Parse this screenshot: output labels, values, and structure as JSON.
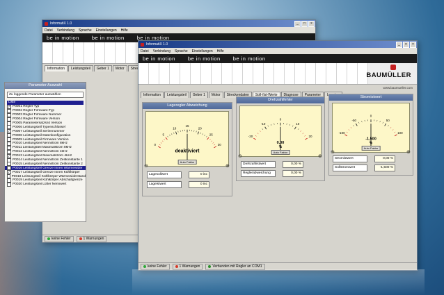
{
  "back_window": {
    "title": "InformatiX 1.0",
    "menu": [
      "Datei",
      "Verbindung",
      "Sprache",
      "Einstellungen",
      "Hilfe"
    ],
    "banner": [
      "be in motion",
      "be in motion",
      "be in motion"
    ],
    "tabs": [
      "Information",
      "Leistungsteil",
      "Geber 1",
      "Motor",
      "Streckenda"
    ],
    "param_panel": {
      "title": "Parameter Auswahl",
      "dropdown": "Zu loggende Parameter auswählen",
      "header": "Liste",
      "rows": [
        {
          "text": "P0001 Regler Typ",
          "checked": true,
          "hl": false
        },
        {
          "text": "P0002 Regler Firmware-Typ",
          "checked": false,
          "hl": false
        },
        {
          "text": "P0003 Regler Firmware Nummer",
          "checked": false,
          "hl": false
        },
        {
          "text": "P0004 Regler Firmware Version",
          "checked": false,
          "hl": false
        },
        {
          "text": "P0005 Parametersatzsnit Version",
          "checked": false,
          "hl": false
        },
        {
          "text": "P0006 Leistungsteil Typenschlüssel",
          "checked": false,
          "hl": false
        },
        {
          "text": "P0007 Leistungsteil Seriennummer",
          "checked": true,
          "hl": false
        },
        {
          "text": "P0008 Leistungsteil Datenkonfiguration",
          "checked": false,
          "hl": false
        },
        {
          "text": "P0009 Leistungsteil Firmware Version",
          "checked": false,
          "hl": false
        },
        {
          "text": "P0010 Leistungsteil Nennstrom 8kHz",
          "checked": false,
          "hl": false
        },
        {
          "text": "P0011 Leistungsteil Maximalstrom 8kHz",
          "checked": false,
          "hl": false
        },
        {
          "text": "P0012 Leistungsteil Nennstrom 4kHz",
          "checked": false,
          "hl": false
        },
        {
          "text": "P0013 Leistungsteil Maximalstrom 4kHz",
          "checked": true,
          "hl": false
        },
        {
          "text": "P0014 Leistungsteil Nennstrom Zeitkonstante 1",
          "checked": false,
          "hl": false
        },
        {
          "text": "P0015 Leistungsteil Nennstrom Zeitkonstante 2",
          "checked": false,
          "hl": false
        },
        {
          "text": "P0016 Leistungsteil Grenze Innen Wärmewider",
          "checked": false,
          "hl": true
        },
        {
          "text": "P0017 Leistungsteil Grenze Innen Kühlkörper",
          "checked": true,
          "hl": false
        },
        {
          "text": "P0018 Leistungsteil Kühlkörper Wärmewiderstand",
          "checked": false,
          "hl": false
        },
        {
          "text": "P0019 Leistungsteil Kühlkörper Abschaltgrenze",
          "checked": false,
          "hl": false
        },
        {
          "text": "P0020 Leistungsteil Lüfter Nennwert",
          "checked": false,
          "hl": false
        }
      ]
    },
    "status": [
      "keine Fehler",
      "1 Warnungen"
    ]
  },
  "front_window": {
    "title": "InformatiX 1.0",
    "menu": [
      "Datei",
      "Verbindung",
      "Sprache",
      "Einstellungen",
      "Hilfe"
    ],
    "banner": [
      "be in motion",
      "be in motion",
      "be in motion"
    ],
    "brand": "BAUMÜLLER",
    "url": "www.baumueller.com",
    "tabs": [
      "Information",
      "Leistungsteil",
      "Geber 1",
      "Motor",
      "Streckendaten",
      "Soll-/Ist-Werte",
      "Diagnose",
      "Parameter",
      "Logging"
    ],
    "active_tab_index": 5,
    "panels": [
      {
        "title": "Lageregler Abweichung",
        "ticks": [
          "0",
          "5",
          "10",
          "15",
          "20",
          "25",
          "30"
        ],
        "value_text": "deaktiviert",
        "button": "Auto Faktor",
        "readouts": [
          {
            "label": "Lagesollwert",
            "value": "0 inc"
          },
          {
            "label": "Lageistwert",
            "value": "0 inc"
          }
        ]
      },
      {
        "title": "Drehzahlfehler",
        "ticks": [
          "-20",
          "-10",
          "0",
          "10",
          "20"
        ],
        "value_text": "0,00",
        "unit": "%",
        "button": "Auto Faktor",
        "readouts": [
          {
            "label": "Drehzahlistwert",
            "value": "0,00 %"
          },
          {
            "label": "Reglerabweichung",
            "value": "0,00 %"
          }
        ]
      },
      {
        "title": "Stromistwert",
        "ticks": [
          "-100",
          "-50",
          "0",
          "50",
          "100"
        ],
        "value_text": "-1,500",
        "unit": "%",
        "button": "Auto Faktor",
        "readouts": [
          {
            "label": "Stromistwert",
            "value": "0,00 %"
          },
          {
            "label": "Sollstromwert",
            "value": "-1,500 %"
          }
        ]
      }
    ],
    "status": [
      "keine Fehler",
      "1 Warnungen",
      "Verbunden mit Regler an COM1"
    ]
  },
  "colors": {
    "ok": "#2fa83a",
    "warn": "#d63a2a",
    "info": "#2c8f2c",
    "accent": "#c62020"
  }
}
